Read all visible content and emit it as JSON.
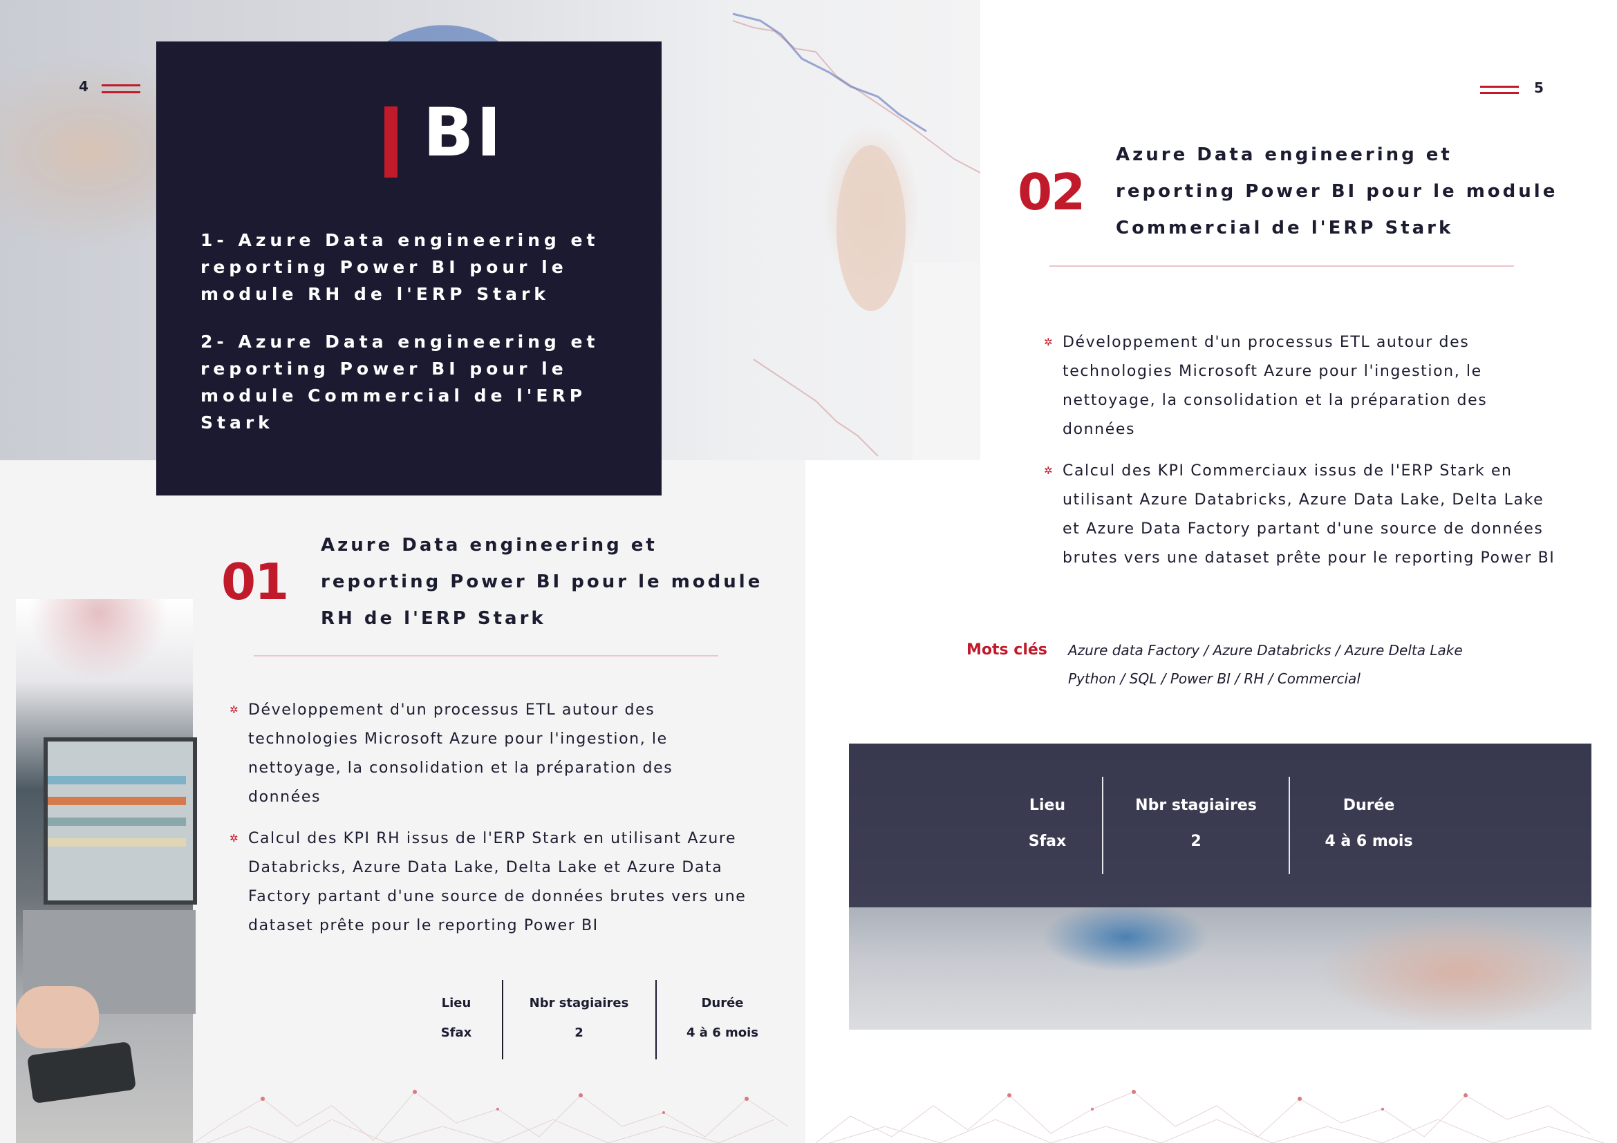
{
  "left_page": {
    "page_number": "4",
    "title_box": {
      "title": "BI",
      "items": [
        "1- Azure Data engineering  et reporting Power BI pour le module RH de l'ERP Stark",
        "2- Azure Data engineering  et reporting Power BI pour le module Commercial de l'ERP Stark"
      ]
    },
    "section": {
      "number": "01",
      "title": "Azure Data engineering  et reporting Power BI pour le module RH de l'ERP Stark",
      "bullets": [
        "Développement d'un processus ETL autour des technologies Microsoft Azure pour l'ingestion, le nettoyage, la consolidation et la préparation des données",
        "Calcul des KPI RH issus de l'ERP Stark en utilisant Azure Databricks, Azure Data Lake, Delta Lake et Azure Data Factory partant d'une source de données brutes vers une dataset prête pour le reporting Power BI"
      ],
      "info": {
        "headers": [
          "Lieu",
          "Nbr stagiaires",
          "Durée"
        ],
        "values": [
          "Sfax",
          "2",
          "4 à 6  mois"
        ]
      }
    }
  },
  "right_page": {
    "page_number": "5",
    "section": {
      "number": "02",
      "title": "Azure Data engineering  et reporting Power BI pour le module Commercial de l'ERP Stark",
      "bullets": [
        "Développement d'un processus ETL autour des technologies Microsoft Azure pour l'ingestion, le nettoyage, la consolidation et la préparation des données",
        "Calcul des KPI Commerciaux issus de l'ERP Stark en utilisant Azure Databricks, Azure Data Lake, Delta Lake et Azure Data Factory partant d'une source de données brutes vers une dataset prête pour le reporting Power BI"
      ],
      "keywords_label": "Mots clés",
      "keywords_lines": [
        "Azure data Factory / Azure Databricks / Azure Delta Lake",
        "Python / SQL / Power BI / RH / Commercial"
      ],
      "info": {
        "headers": [
          "Lieu",
          "Nbr stagiaires",
          "Durée"
        ],
        "values": [
          "Sfax",
          "2",
          "4 à 6 mois"
        ]
      }
    }
  },
  "colors": {
    "accent_red": "#c01a2b",
    "navy": "#1c1a30",
    "text": "#1c1c30",
    "divider": "#e9c6c8"
  }
}
